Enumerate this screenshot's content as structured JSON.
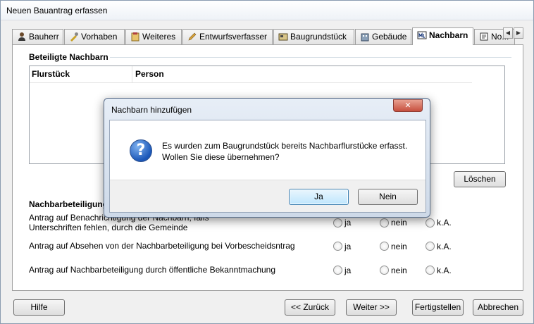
{
  "window": {
    "title": "Neuen Bauantrag erfassen"
  },
  "tabs": [
    {
      "label": "Bauherr",
      "icon": "person-icon"
    },
    {
      "label": "Vorhaben",
      "icon": "tools-icon"
    },
    {
      "label": "Weiteres",
      "icon": "clipboard-icon"
    },
    {
      "label": "Entwurfsverfasser",
      "icon": "pen-icon"
    },
    {
      "label": "Baugrundstück",
      "icon": "plot-icon"
    },
    {
      "label": "Gebäude",
      "icon": "building-icon"
    },
    {
      "label": "Nachbarn",
      "icon": "neighbors-icon",
      "active": true
    },
    {
      "label": "No...",
      "icon": "notes-icon"
    }
  ],
  "tab_scroll": {
    "left": "◀",
    "right": "▶"
  },
  "neighbors": {
    "section_title": "Beteiligte Nachbarn",
    "columns": [
      "Flurstück",
      "Person"
    ],
    "rows": [],
    "delete_button": "Löschen"
  },
  "participation": {
    "section_title": "Nachbarbeteiligung",
    "questions": [
      {
        "line1": "Antrag auf Benachrichtigung der Nachbarn, falls",
        "line2": "Unterschriften fehlen, durch die Gemeinde"
      },
      {
        "line1": "Antrag auf Absehen von der Nachbarbeteiligung bei Vorbescheidsntrag",
        "line2": ""
      },
      {
        "line1": "Antrag auf Nachbarbeteiligung durch öffentliche Bekanntmachung",
        "line2": ""
      }
    ],
    "options": [
      "ja",
      "nein",
      "k.A."
    ]
  },
  "footer": {
    "help": "Hilfe",
    "back": "<< Zurück",
    "next": "Weiter >>",
    "finish": "Fertigstellen",
    "cancel": "Abbrechen"
  },
  "dialog": {
    "title": "Nachbarn hinzufügen",
    "close": "✕",
    "icon": "question-icon",
    "message_line1": "Es wurden zum Baugrundstück bereits Nachbarflurstücke erfasst.",
    "message_line2": "Wollen Sie diese übernehmen?",
    "yes": "Ja",
    "no": "Nein"
  }
}
